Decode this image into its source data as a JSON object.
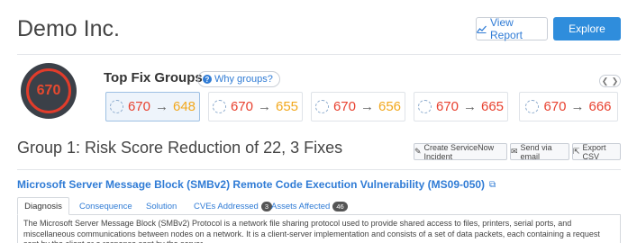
{
  "header": {
    "company": "Demo Inc.",
    "view_report_label": "View Report",
    "explore_label": "Explore"
  },
  "score": {
    "value": "670",
    "color": "#e8492f"
  },
  "top_fix_groups": {
    "title": "Top Fix Groups",
    "why_label": "Why groups?",
    "cards": [
      {
        "from": "670",
        "arrow": "→",
        "to": "648",
        "to_color": "#f2a81d"
      },
      {
        "from": "670",
        "arrow": "→",
        "to": "655",
        "to_color": "#f2a81d"
      },
      {
        "from": "670",
        "arrow": "→",
        "to": "656",
        "to_color": "#f2a81d"
      },
      {
        "from": "670",
        "arrow": "→",
        "to": "665",
        "to_color": "#e8412f"
      },
      {
        "from": "670",
        "arrow": "→",
        "to": "666",
        "to_color": "#e8412f"
      }
    ]
  },
  "group": {
    "title": "Group 1: Risk Score Reduction of 22, 3 Fixes",
    "actions": {
      "servicenow": "Create ServiceNow Incident",
      "email": "Send via email",
      "csv": "Export CSV"
    }
  },
  "vulnerability": {
    "title": "Microsoft Server Message Block (SMBv2) Remote Code Execution Vulnerability (MS09-050)",
    "tabs": [
      {
        "label": "Diagnosis"
      },
      {
        "label": "Consequence"
      },
      {
        "label": "Solution"
      },
      {
        "label": "CVEs Addressed",
        "badge": "3"
      },
      {
        "label": "Assets Affected",
        "badge": "46"
      }
    ],
    "description": "The Microsoft Server Message Block (SMBv2) Protocol is a network file sharing protocol used to provide shared access to files, printers, serial ports, and miscellaneous communications between nodes on a network. It is a client-server implementation and consists of a set of data packets, each containing a request sent by the client or a response sent by the server."
  },
  "colors": {
    "accent": "#2f8ddc",
    "link": "#2f7bd5",
    "danger": "#e8412f",
    "warning": "#f2a81d"
  }
}
